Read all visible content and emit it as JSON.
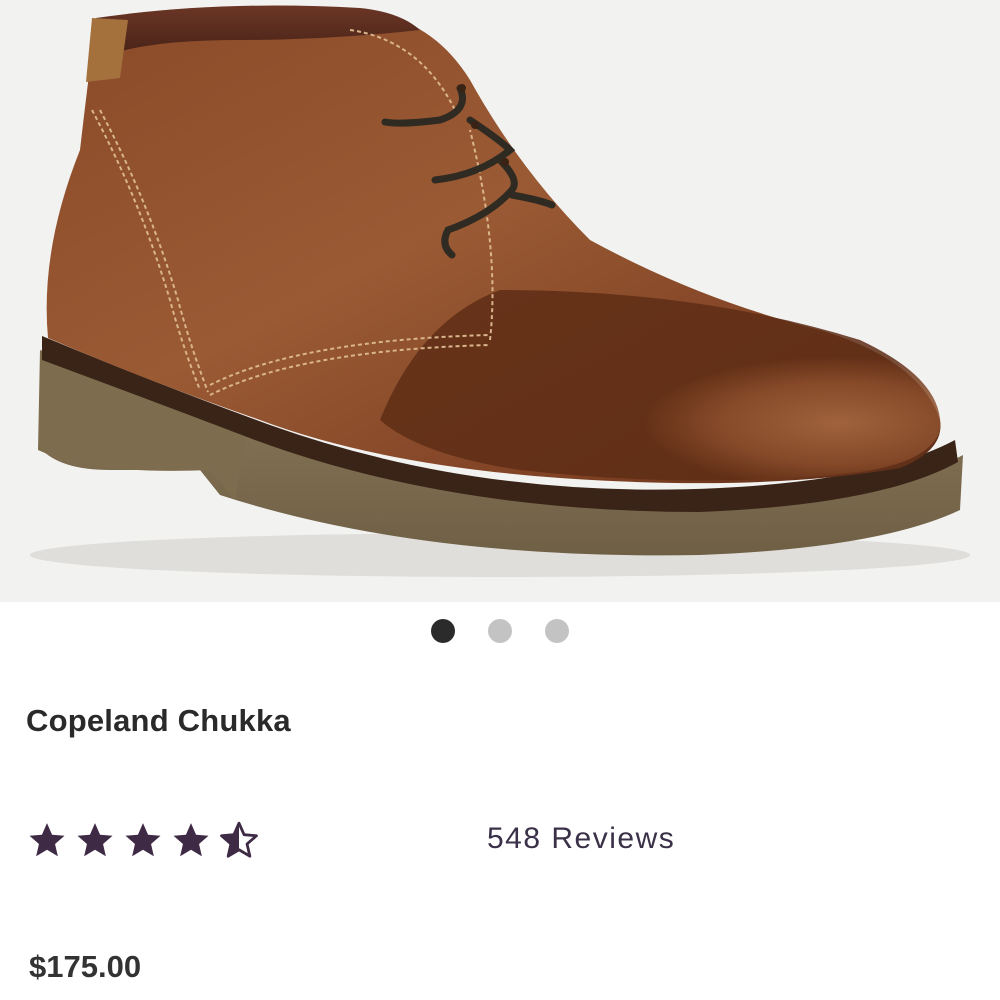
{
  "product": {
    "image_alt": "brown-leather-chukka-boot",
    "carousel": {
      "slide_count": 3,
      "active_index": 0
    },
    "name": "Copeland Chukka",
    "rating": {
      "value": 4.5,
      "max": 5,
      "reviews_label": "548 Reviews"
    },
    "price": "$175.00"
  },
  "colors": {
    "image_background": "#f2f2f1",
    "star_color": "#3e2a45",
    "dot_active": "#2b2b2b",
    "dot_inactive": "#c3c3c3",
    "title_text": "#2a2a2a",
    "reviews_text": "#3a3048",
    "price_text": "#333333"
  },
  "icons": {
    "star": "star-icon",
    "half_star": "star-half-icon"
  }
}
